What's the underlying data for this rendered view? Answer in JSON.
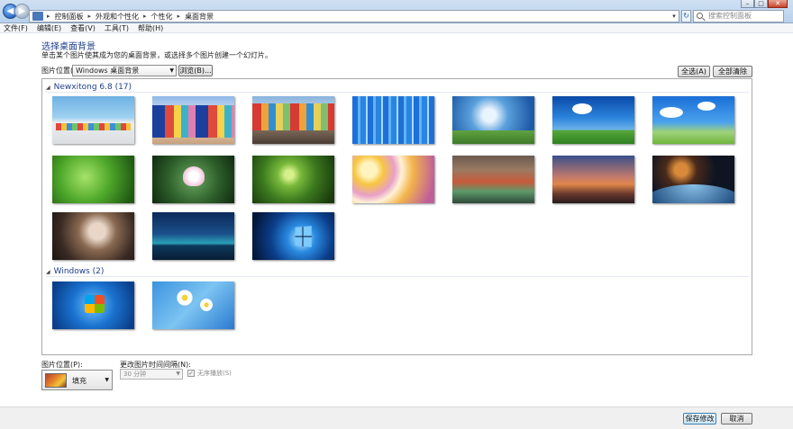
{
  "address_bar": {
    "crumbs": [
      "控制面板",
      "外观和个性化",
      "个性化",
      "桌面背景"
    ],
    "search_placeholder": "搜索控制面板"
  },
  "menu": [
    "文件(F)",
    "编辑(E)",
    "查看(V)",
    "工具(T)",
    "帮助(H)"
  ],
  "page": {
    "title": "选择桌面背景",
    "description": "单击某个图片使其成为您的桌面背景，或选择多个图片创建一个幻灯片。"
  },
  "location": {
    "label": "图片位置(L):",
    "value": "Windows 桌面背景",
    "browse": "浏览(B)...",
    "select_all": "全选(A)",
    "clear_all": "全部清除(C)"
  },
  "groups": [
    {
      "title": "Newxitong 6.8 (17)",
      "thumbnails": [
        {
          "name": "beach-cabins"
        },
        {
          "name": "colorful-huts-flag"
        },
        {
          "name": "canal-houses"
        },
        {
          "name": "blue-forest"
        },
        {
          "name": "wind-turbine-road"
        },
        {
          "name": "green-field-sky"
        },
        {
          "name": "meadow-clouds"
        },
        {
          "name": "green-leaf"
        },
        {
          "name": "lotus-flower"
        },
        {
          "name": "fern-spiral"
        },
        {
          "name": "plumeria-flowers"
        },
        {
          "name": "canyon-valley"
        },
        {
          "name": "mountain-sunset"
        },
        {
          "name": "planet-space"
        },
        {
          "name": "woman-portrait"
        },
        {
          "name": "night-hills"
        },
        {
          "name": "windows10-logo"
        }
      ]
    },
    {
      "title": "Windows (2)",
      "thumbnails": [
        {
          "name": "windows7-logo"
        },
        {
          "name": "daisies-blue"
        }
      ]
    }
  ],
  "position": {
    "label": "图片位置(P):",
    "value": "填充"
  },
  "interval": {
    "label": "更改图片时间间隔(N):",
    "value": "30 分钟",
    "shuffle_label": "无序播放(S)"
  },
  "footer": {
    "save": "保存修改",
    "cancel": "取消"
  }
}
